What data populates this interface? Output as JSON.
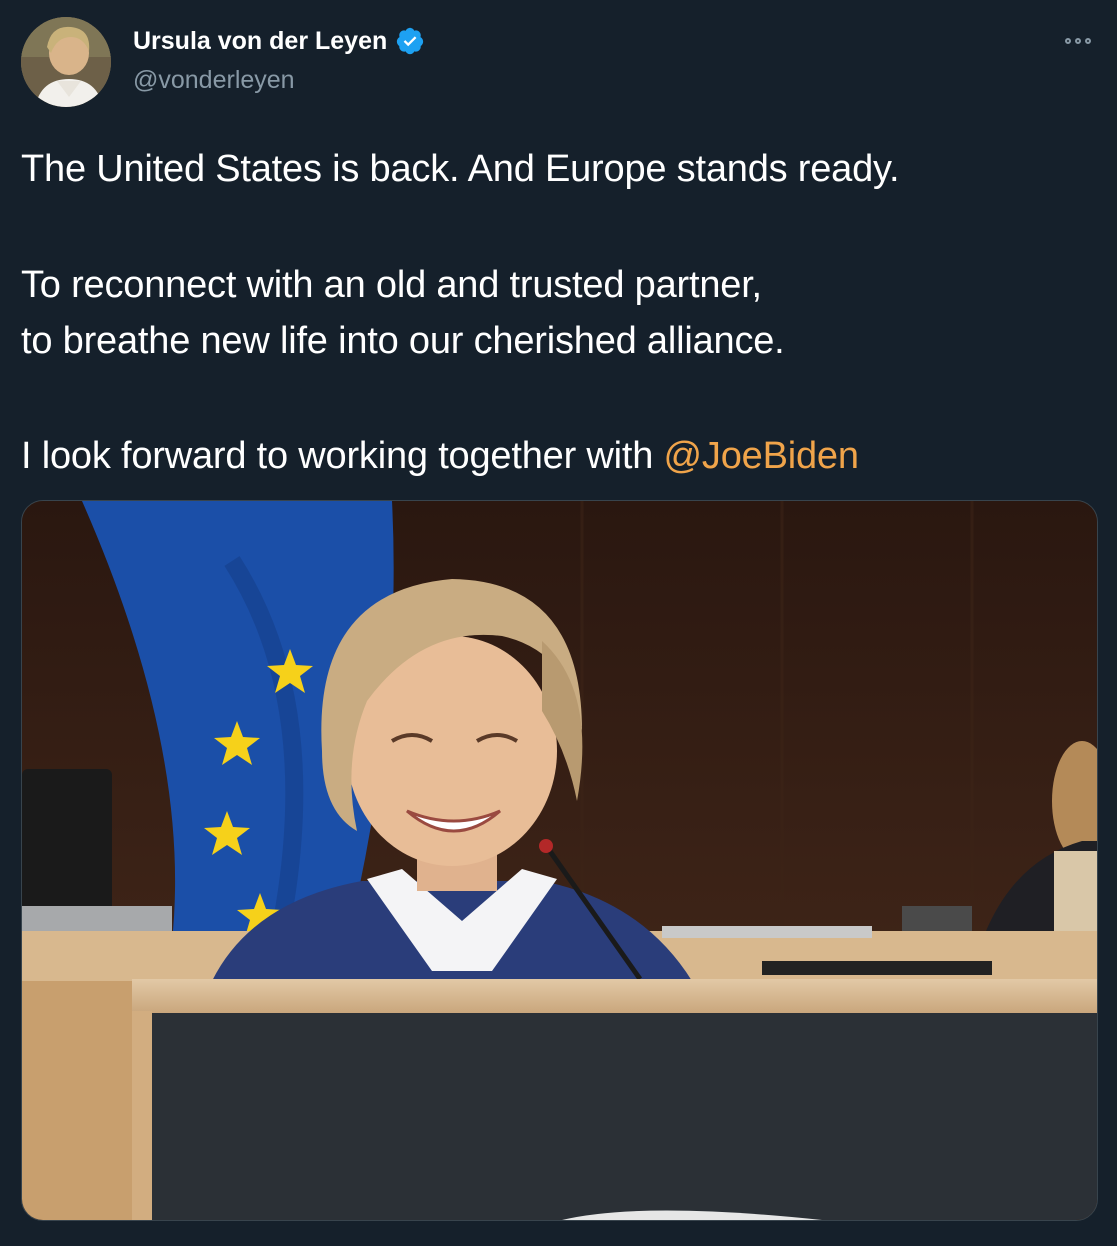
{
  "author": {
    "display_name": "Ursula von der Leyen",
    "handle": "@vonderleyen",
    "verified": true,
    "verified_icon": "verified-badge-icon",
    "avatar_icon": "profile-photo"
  },
  "menu": {
    "icon": "more-options-icon"
  },
  "tweet": {
    "line1": "The United States is back. And Europe stands ready.",
    "line2": "To reconnect with an old and trusted partner,",
    "line3": "to breathe new life into our cherished alliance.",
    "line4_prefix": "I look forward to working together with ",
    "mention": "@JoeBiden"
  },
  "media": {
    "type": "photo",
    "description_icon": "tweet-photo"
  },
  "colors": {
    "background": "#15202b",
    "text": "#ffffff",
    "secondary_text": "#8899a6",
    "mention": "#f0a44a",
    "verified": "#1da1f2"
  }
}
